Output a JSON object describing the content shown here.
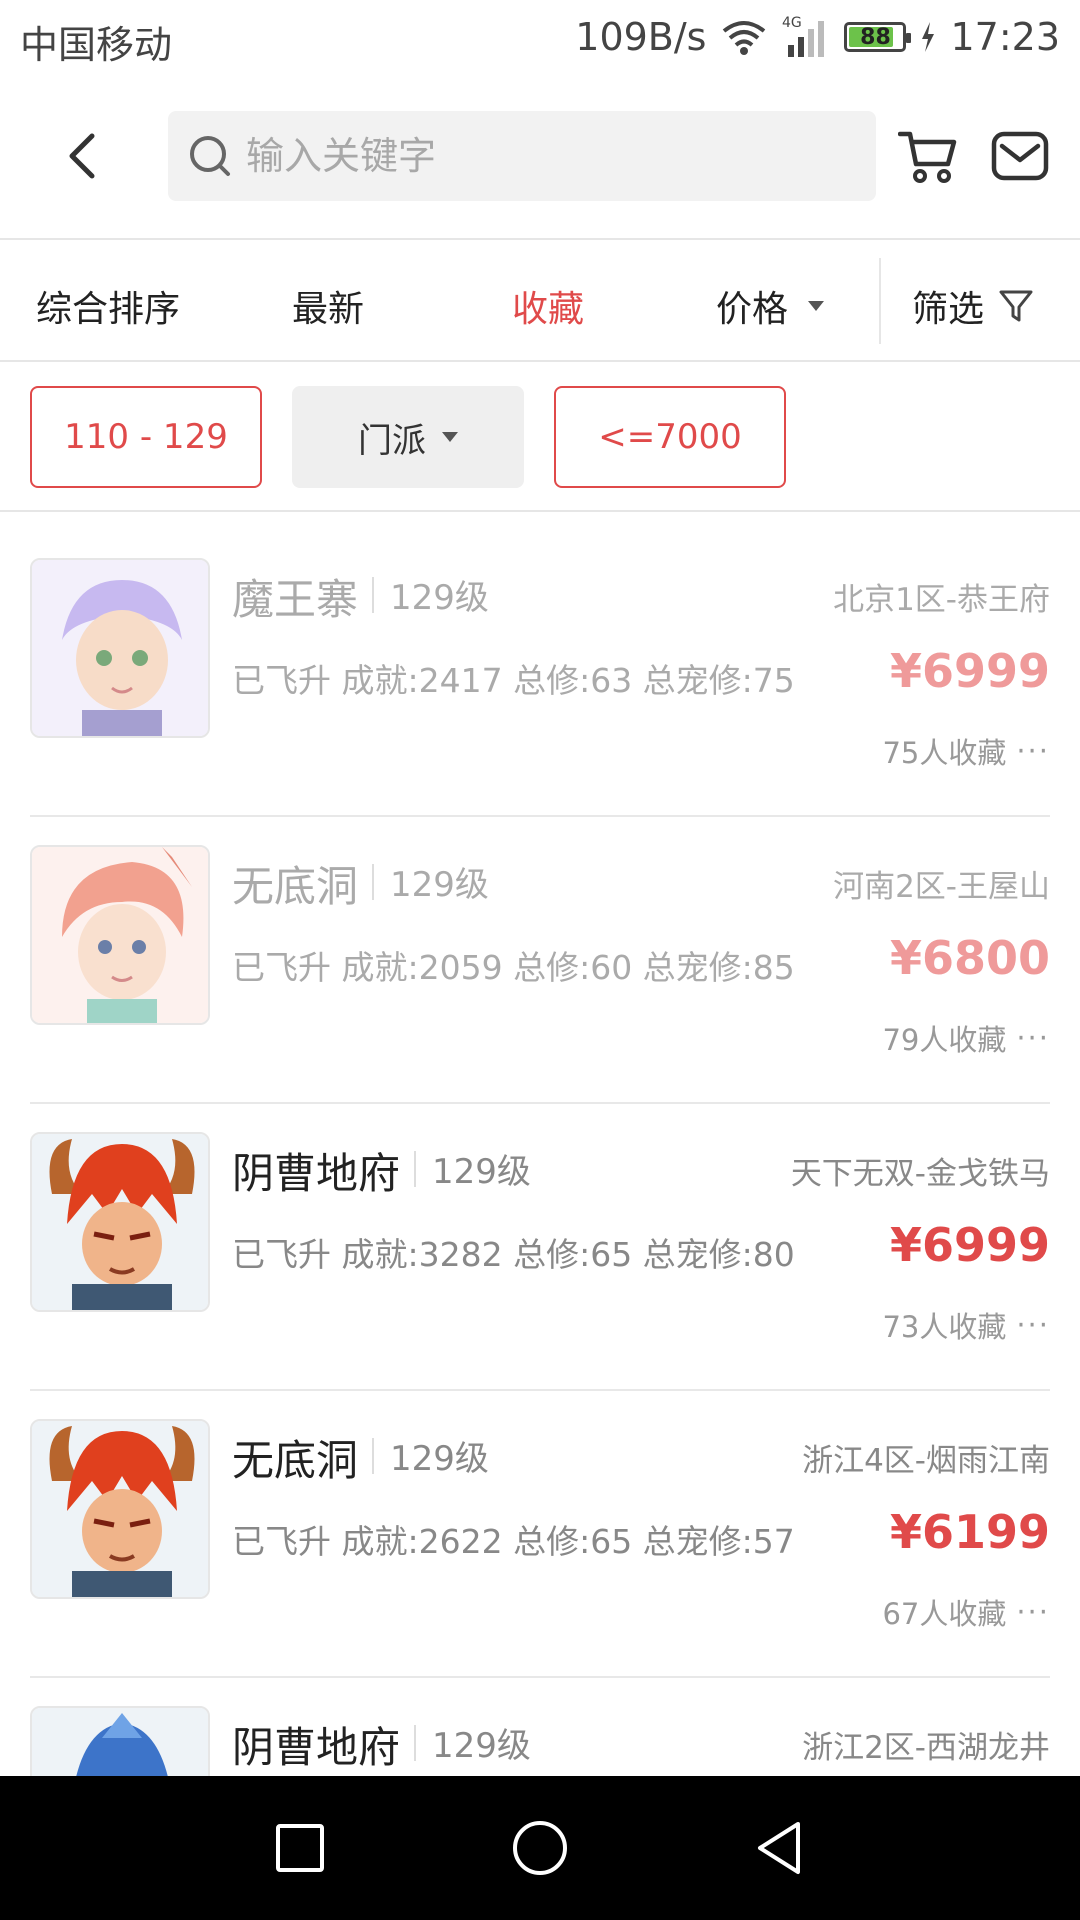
{
  "status": {
    "carrier": "中国移动",
    "speed": "109B/s",
    "network": "4G",
    "battery": "88",
    "time": "17:23"
  },
  "header": {
    "search_placeholder": "输入关键字"
  },
  "sort": {
    "items": [
      "综合排序",
      "最新",
      "收藏",
      "价格",
      "筛选"
    ],
    "active": "收藏"
  },
  "chips": {
    "level_range": "110 - 129",
    "school": "门派",
    "price_max": "<=7000"
  },
  "listings": [
    {
      "name": "魔王寨",
      "level": "129级",
      "server": "北京1区-恭王府",
      "attrs": "已飞升 成就:2417 总修:63 总宠修:75",
      "price": "¥6999",
      "favs": "75人收藏"
    },
    {
      "name": "无底洞",
      "level": "129级",
      "server": "河南2区-王屋山",
      "attrs": "已飞升 成就:2059 总修:60 总宠修:85",
      "price": "¥6800",
      "favs": "79人收藏"
    },
    {
      "name": "阴曹地府",
      "level": "129级",
      "server": "天下无双-金戈铁马",
      "attrs": "已飞升 成就:3282 总修:65 总宠修:80",
      "price": "¥6999",
      "favs": "73人收藏"
    },
    {
      "name": "无底洞",
      "level": "129级",
      "server": "浙江4区-烟雨江南",
      "attrs": "已飞升 成就:2622 总修:65 总宠修:57",
      "price": "¥6199",
      "favs": "67人收藏"
    },
    {
      "name": "阴曹地府",
      "level": "129级",
      "server": "浙江2区-西湖龙井",
      "attrs": "",
      "price": "",
      "favs": ""
    }
  ],
  "colors": {
    "accent": "#e04a4a",
    "divider": "#e6e6e6"
  }
}
